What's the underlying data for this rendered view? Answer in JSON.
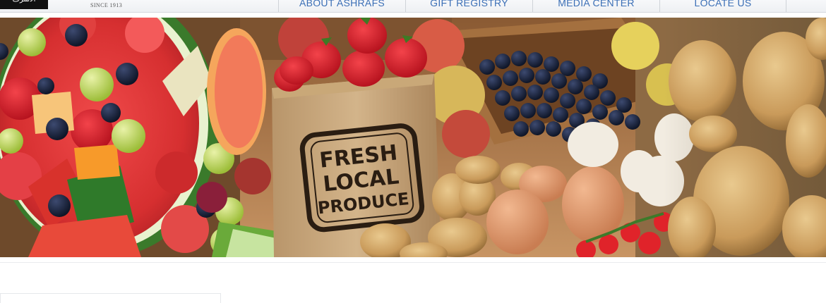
{
  "header": {
    "logo_text": "الأشرف",
    "since": "SINCE 1913"
  },
  "nav": {
    "items": [
      {
        "label": "ABOUT ASHRAFS"
      },
      {
        "label": "GIFT REGISTRY"
      },
      {
        "label": "MEDIA CENTER"
      },
      {
        "label": "LOCATE US"
      }
    ]
  },
  "hero": {
    "bag_text_line1": "FRESH",
    "bag_text_line2": "LOCAL",
    "bag_text_line3": "PRODUCE"
  }
}
